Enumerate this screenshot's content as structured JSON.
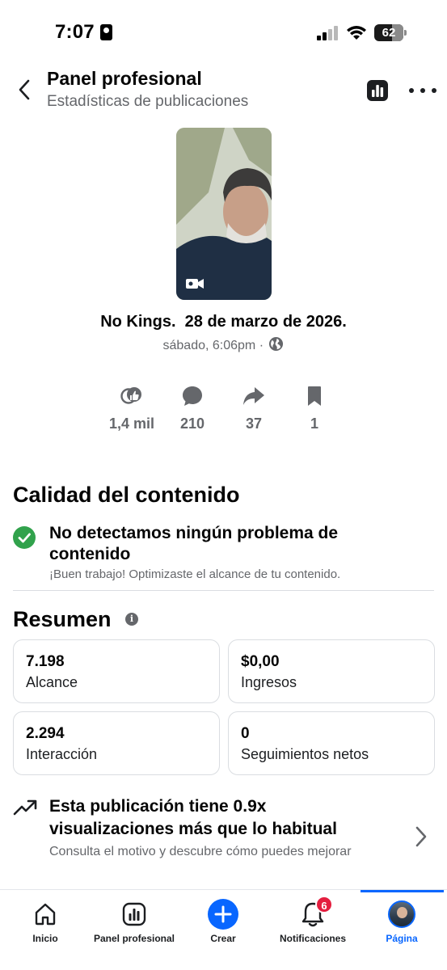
{
  "status_bar": {
    "time": "7:07",
    "battery": "62"
  },
  "header": {
    "title": "Panel profesional",
    "subtitle": "Estadísticas de publicaciones"
  },
  "post": {
    "caption": "No Kings.  28 de marzo de 2026.",
    "meta": "sábado, 6:06pm ·"
  },
  "stats": [
    {
      "icon": "reactions-icon",
      "value": "1,4 mil"
    },
    {
      "icon": "comment-icon",
      "value": "210"
    },
    {
      "icon": "share-icon",
      "value": "37"
    },
    {
      "icon": "bookmark-icon",
      "value": "1"
    }
  ],
  "quality": {
    "title": "Calidad del contenido",
    "headline": "No detectamos ningún problema de contenido",
    "description": "¡Buen trabajo! Optimizaste el alcance de tu contenido."
  },
  "summary": {
    "title": "Resumen",
    "cards": [
      {
        "value": "7.198",
        "label": "Alcance"
      },
      {
        "value": "$0,00",
        "label": "Ingresos"
      },
      {
        "value": "2.294",
        "label": "Interacción"
      },
      {
        "value": "0",
        "label": "Seguimientos netos"
      }
    ]
  },
  "performance": {
    "title": "Esta publicación tiene 0.9x visualizaciones más que lo habitual",
    "subtitle": "Consulta el motivo y descubre cómo puedes mejorar"
  },
  "bottom_nav": {
    "items": [
      {
        "label": "Inicio",
        "icon": "home-icon"
      },
      {
        "label": "Panel profesional",
        "icon": "dashboard-icon"
      },
      {
        "label": "Crear",
        "icon": "plus-icon"
      },
      {
        "label": "Notificaciones",
        "icon": "bell-icon",
        "badge": "6"
      },
      {
        "label": "Página",
        "icon": "avatar",
        "active": true
      }
    ]
  },
  "colors": {
    "accent": "#0866ff",
    "success": "#31a24c",
    "badge": "#e41e3f",
    "secondary_text": "#65676b"
  }
}
